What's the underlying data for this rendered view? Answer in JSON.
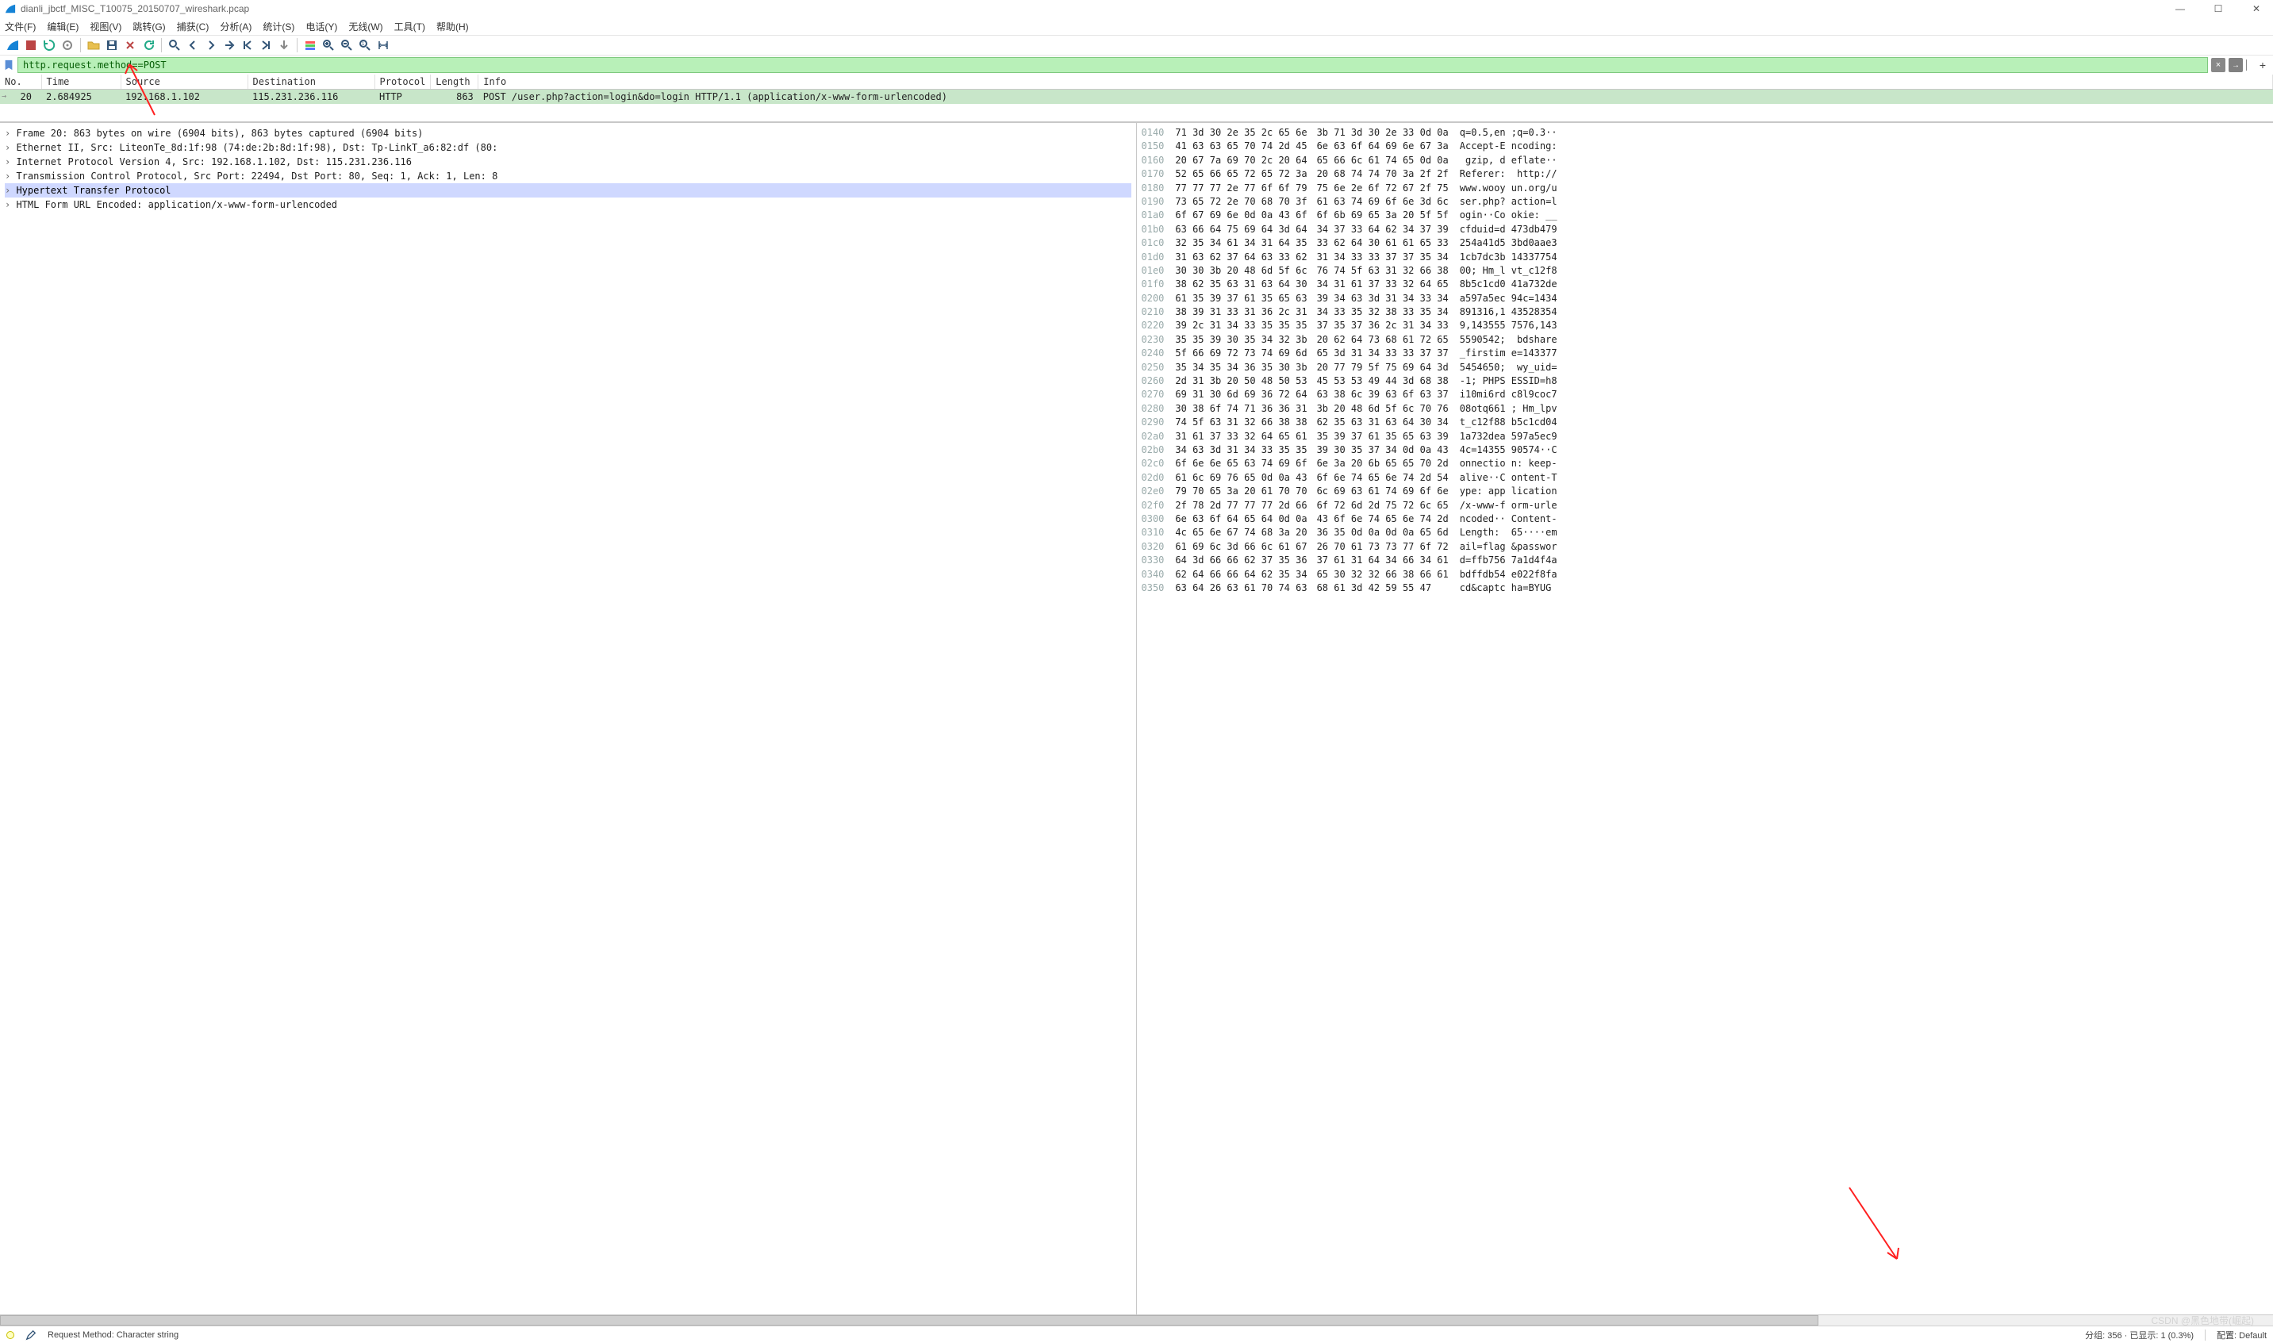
{
  "title": "dianli_jbctf_MISC_T10075_20150707_wireshark.pcap",
  "winbtns": {
    "min": "—",
    "max": "☐",
    "close": "✕"
  },
  "menus": [
    "文件(F)",
    "编辑(E)",
    "视图(V)",
    "跳转(G)",
    "捕获(C)",
    "分析(A)",
    "统计(S)",
    "电话(Y)",
    "无线(W)",
    "工具(T)",
    "帮助(H)"
  ],
  "filter": {
    "value": "http.request.method==POST",
    "clear": "×",
    "arrow": "→",
    "plus": "+"
  },
  "list": {
    "headers": [
      "No.",
      "Time",
      "Source",
      "Destination",
      "Protocol",
      "Length",
      "Info"
    ],
    "row": {
      "no": "20",
      "time": "2.684925",
      "src": "192.168.1.102",
      "dst": "115.231.236.116",
      "proto": "HTTP",
      "len": "863",
      "info": "POST /user.php?action=login&do=login HTTP/1.1   (application/x-www-form-urlencoded)"
    }
  },
  "details": [
    "Frame 20: 863 bytes on wire (6904 bits), 863 bytes captured (6904 bits)",
    "Ethernet II, Src: LiteonTe_8d:1f:98 (74:de:2b:8d:1f:98), Dst: Tp-LinkT_a6:82:df (80:",
    "Internet Protocol Version 4, Src: 192.168.1.102, Dst: 115.231.236.116",
    "Transmission Control Protocol, Src Port: 22494, Dst Port: 80, Seq: 1, Ack: 1, Len: 8",
    "Hypertext Transfer Protocol",
    "HTML Form URL Encoded: application/x-www-form-urlencoded"
  ],
  "details_sel_index": 4,
  "hex": [
    {
      "o": "0140",
      "h1": "71 3d 30 2e 35 2c 65 6e",
      "h2": "3b 71 3d 30 2e 33 0d 0a",
      "a1": "q=0.5,en",
      "a2": ";q=0.3··"
    },
    {
      "o": "0150",
      "h1": "41 63 63 65 70 74 2d 45",
      "h2": "6e 63 6f 64 69 6e 67 3a",
      "a1": "Accept-E",
      "a2": "ncoding:"
    },
    {
      "o": "0160",
      "h1": "20 67 7a 69 70 2c 20 64",
      "h2": "65 66 6c 61 74 65 0d 0a",
      "a1": " gzip, d",
      "a2": "eflate··"
    },
    {
      "o": "0170",
      "h1": "52 65 66 65 72 65 72 3a",
      "h2": "20 68 74 74 70 3a 2f 2f",
      "a1": "Referer:",
      "a2": " http://"
    },
    {
      "o": "0180",
      "h1": "77 77 77 2e 77 6f 6f 79",
      "h2": "75 6e 2e 6f 72 67 2f 75",
      "a1": "www.wooy",
      "a2": "un.org/u"
    },
    {
      "o": "0190",
      "h1": "73 65 72 2e 70 68 70 3f",
      "h2": "61 63 74 69 6f 6e 3d 6c",
      "a1": "ser.php?",
      "a2": "action=l"
    },
    {
      "o": "01a0",
      "h1": "6f 67 69 6e 0d 0a 43 6f",
      "h2": "6f 6b 69 65 3a 20 5f 5f",
      "a1": "ogin··Co",
      "a2": "okie: __"
    },
    {
      "o": "01b0",
      "h1": "63 66 64 75 69 64 3d 64",
      "h2": "34 37 33 64 62 34 37 39",
      "a1": "cfduid=d",
      "a2": "473db479"
    },
    {
      "o": "01c0",
      "h1": "32 35 34 61 34 31 64 35",
      "h2": "33 62 64 30 61 61 65 33",
      "a1": "254a41d5",
      "a2": "3bd0aae3"
    },
    {
      "o": "01d0",
      "h1": "31 63 62 37 64 63 33 62",
      "h2": "31 34 33 33 37 37 35 34",
      "a1": "1cb7dc3b",
      "a2": "14337754"
    },
    {
      "o": "01e0",
      "h1": "30 30 3b 20 48 6d 5f 6c",
      "h2": "76 74 5f 63 31 32 66 38",
      "a1": "00; Hm_l",
      "a2": "vt_c12f8"
    },
    {
      "o": "01f0",
      "h1": "38 62 35 63 31 63 64 30",
      "h2": "34 31 61 37 33 32 64 65",
      "a1": "8b5c1cd0",
      "a2": "41a732de"
    },
    {
      "o": "0200",
      "h1": "61 35 39 37 61 35 65 63",
      "h2": "39 34 63 3d 31 34 33 34",
      "a1": "a597a5ec",
      "a2": "94c=1434"
    },
    {
      "o": "0210",
      "h1": "38 39 31 33 31 36 2c 31",
      "h2": "34 33 35 32 38 33 35 34",
      "a1": "891316,1",
      "a2": "43528354"
    },
    {
      "o": "0220",
      "h1": "39 2c 31 34 33 35 35 35",
      "h2": "37 35 37 36 2c 31 34 33",
      "a1": "9,143555",
      "a2": "7576,143"
    },
    {
      "o": "0230",
      "h1": "35 35 39 30 35 34 32 3b",
      "h2": "20 62 64 73 68 61 72 65",
      "a1": "5590542;",
      "a2": " bdshare"
    },
    {
      "o": "0240",
      "h1": "5f 66 69 72 73 74 69 6d",
      "h2": "65 3d 31 34 33 33 37 37",
      "a1": "_firstim",
      "a2": "e=143377"
    },
    {
      "o": "0250",
      "h1": "35 34 35 34 36 35 30 3b",
      "h2": "20 77 79 5f 75 69 64 3d",
      "a1": "5454650;",
      "a2": " wy_uid="
    },
    {
      "o": "0260",
      "h1": "2d 31 3b 20 50 48 50 53",
      "h2": "45 53 53 49 44 3d 68 38",
      "a1": "-1; PHPS",
      "a2": "ESSID=h8"
    },
    {
      "o": "0270",
      "h1": "69 31 30 6d 69 36 72 64",
      "h2": "63 38 6c 39 63 6f 63 37",
      "a1": "i10mi6rd",
      "a2": "c8l9coc7"
    },
    {
      "o": "0280",
      "h1": "30 38 6f 74 71 36 36 31",
      "h2": "3b 20 48 6d 5f 6c 70 76",
      "a1": "08otq661",
      "a2": "; Hm_lpv"
    },
    {
      "o": "0290",
      "h1": "74 5f 63 31 32 66 38 38",
      "h2": "62 35 63 31 63 64 30 34",
      "a1": "t_c12f88",
      "a2": "b5c1cd04"
    },
    {
      "o": "02a0",
      "h1": "31 61 37 33 32 64 65 61",
      "h2": "35 39 37 61 35 65 63 39",
      "a1": "1a732dea",
      "a2": "597a5ec9"
    },
    {
      "o": "02b0",
      "h1": "34 63 3d 31 34 33 35 35",
      "h2": "39 30 35 37 34 0d 0a 43",
      "a1": "4c=14355",
      "a2": "90574··C"
    },
    {
      "o": "02c0",
      "h1": "6f 6e 6e 65 63 74 69 6f",
      "h2": "6e 3a 20 6b 65 65 70 2d",
      "a1": "onnectio",
      "a2": "n: keep-"
    },
    {
      "o": "02d0",
      "h1": "61 6c 69 76 65 0d 0a 43",
      "h2": "6f 6e 74 65 6e 74 2d 54",
      "a1": "alive··C",
      "a2": "ontent-T"
    },
    {
      "o": "02e0",
      "h1": "79 70 65 3a 20 61 70 70",
      "h2": "6c 69 63 61 74 69 6f 6e",
      "a1": "ype: app",
      "a2": "lication"
    },
    {
      "o": "02f0",
      "h1": "2f 78 2d 77 77 77 2d 66",
      "h2": "6f 72 6d 2d 75 72 6c 65",
      "a1": "/x-www-f",
      "a2": "orm-urle"
    },
    {
      "o": "0300",
      "h1": "6e 63 6f 64 65 64 0d 0a",
      "h2": "43 6f 6e 74 65 6e 74 2d",
      "a1": "ncoded··",
      "a2": "Content-"
    },
    {
      "o": "0310",
      "h1": "4c 65 6e 67 74 68 3a 20",
      "h2": "36 35 0d 0a 0d 0a 65 6d",
      "a1": "Length: ",
      "a2": "65····em"
    },
    {
      "o": "0320",
      "h1": "61 69 6c 3d 66 6c 61 67",
      "h2": "26 70 61 73 73 77 6f 72",
      "a1": "ail=flag",
      "a2": "&passwor"
    },
    {
      "o": "0330",
      "h1": "64 3d 66 66 62 37 35 36",
      "h2": "37 61 31 64 34 66 34 61",
      "a1": "d=ffb756",
      "a2": "7a1d4f4a"
    },
    {
      "o": "0340",
      "h1": "62 64 66 66 64 62 35 34",
      "h2": "65 30 32 32 66 38 66 61",
      "a1": "bdffdb54",
      "a2": "e022f8fa"
    },
    {
      "o": "0350",
      "h1": "63 64 26 63 61 70 74 63",
      "h2": "68 61 3d 42 59 55 47   ",
      "a1": "cd&captc",
      "a2": "ha=BYUG"
    }
  ],
  "status": {
    "left": "Request Method: Character string",
    "packets": "分组: 356  ·  已显示: 1 (0.3%)",
    "profile": "配置: Default"
  },
  "watermark": "CSDN @黑色地带(崛起)"
}
